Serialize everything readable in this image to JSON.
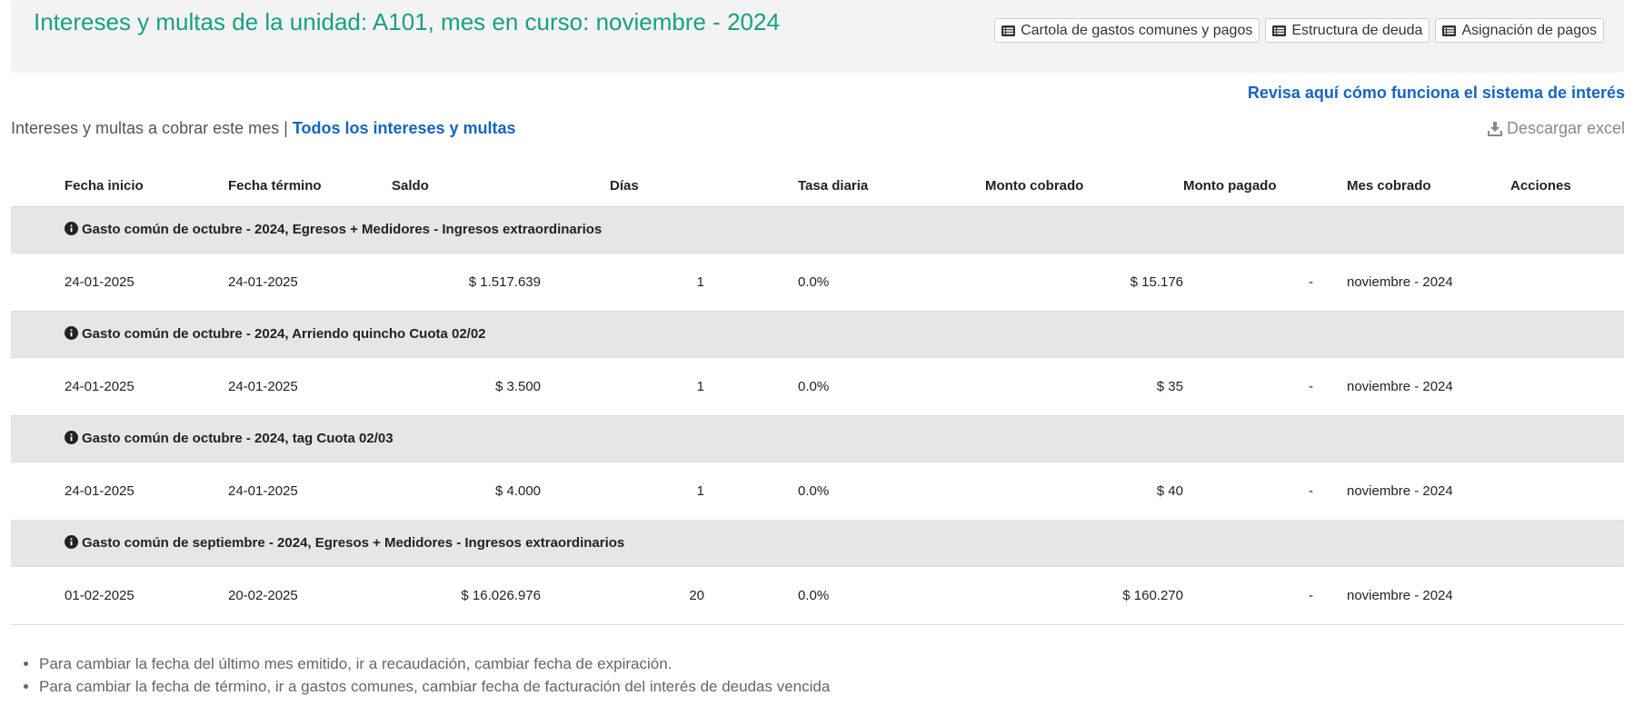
{
  "header": {
    "title": "Intereses y multas de la unidad: A101, mes en curso: noviembre - 2024",
    "buttons": [
      {
        "label": "Cartola de gastos comunes y pagos",
        "icon": "list-icon"
      },
      {
        "label": "Estructura de deuda",
        "icon": "list-icon"
      },
      {
        "label": "Asignación de pagos",
        "icon": "list-icon"
      }
    ]
  },
  "help_link": "Revisa aquí cómo funciona el sistema de interés",
  "filter": {
    "current_label": "Intereses y multas a cobrar este mes",
    "separator": "|",
    "all_link": "Todos los intereses y multas"
  },
  "download": {
    "label": "Descargar excel",
    "icon": "download-icon"
  },
  "table": {
    "columns": [
      "Fecha inicio",
      "Fecha término",
      "Saldo",
      "Días",
      "Tasa diaria",
      "Monto cobrado",
      "Monto pagado",
      "Mes cobrado",
      "Acciones"
    ],
    "groups": [
      {
        "title": "Gasto común de octubre - 2024, Egresos + Medidores - Ingresos extraordinarios",
        "row": {
          "start": "24-01-2025",
          "end": "24-01-2025",
          "saldo": "$ 1.517.639",
          "dias": "1",
          "tasa": "0.0%",
          "cobrado": "$ 15.176",
          "pagado": "-",
          "mes": "noviembre - 2024"
        }
      },
      {
        "title": "Gasto común de octubre - 2024, Arriendo quincho Cuota 02/02",
        "row": {
          "start": "24-01-2025",
          "end": "24-01-2025",
          "saldo": "$ 3.500",
          "dias": "1",
          "tasa": "0.0%",
          "cobrado": "$ 35",
          "pagado": "-",
          "mes": "noviembre - 2024"
        }
      },
      {
        "title": "Gasto común de octubre - 2024, tag Cuota 02/03",
        "row": {
          "start": "24-01-2025",
          "end": "24-01-2025",
          "saldo": "$ 4.000",
          "dias": "1",
          "tasa": "0.0%",
          "cobrado": "$ 40",
          "pagado": "-",
          "mes": "noviembre - 2024"
        }
      },
      {
        "title": "Gasto común de septiembre - 2024, Egresos + Medidores - Ingresos extraordinarios",
        "row": {
          "start": "01-02-2025",
          "end": "20-02-2025",
          "saldo": "$ 16.026.976",
          "dias": "20",
          "tasa": "0.0%",
          "cobrado": "$ 160.270",
          "pagado": "-",
          "mes": "noviembre - 2024"
        }
      }
    ]
  },
  "notes": [
    "Para cambiar la fecha del último mes emitido, ir a recaudación, cambiar fecha de expiración.",
    "Para cambiar la fecha de término, ir a gastos comunes, cambiar fecha de facturación del interés de deudas vencida"
  ],
  "colors": {
    "title": "#16a085",
    "link": "#1565c0",
    "group_bg": "#e6e6e6",
    "header_bg": "#f3f3f3"
  }
}
